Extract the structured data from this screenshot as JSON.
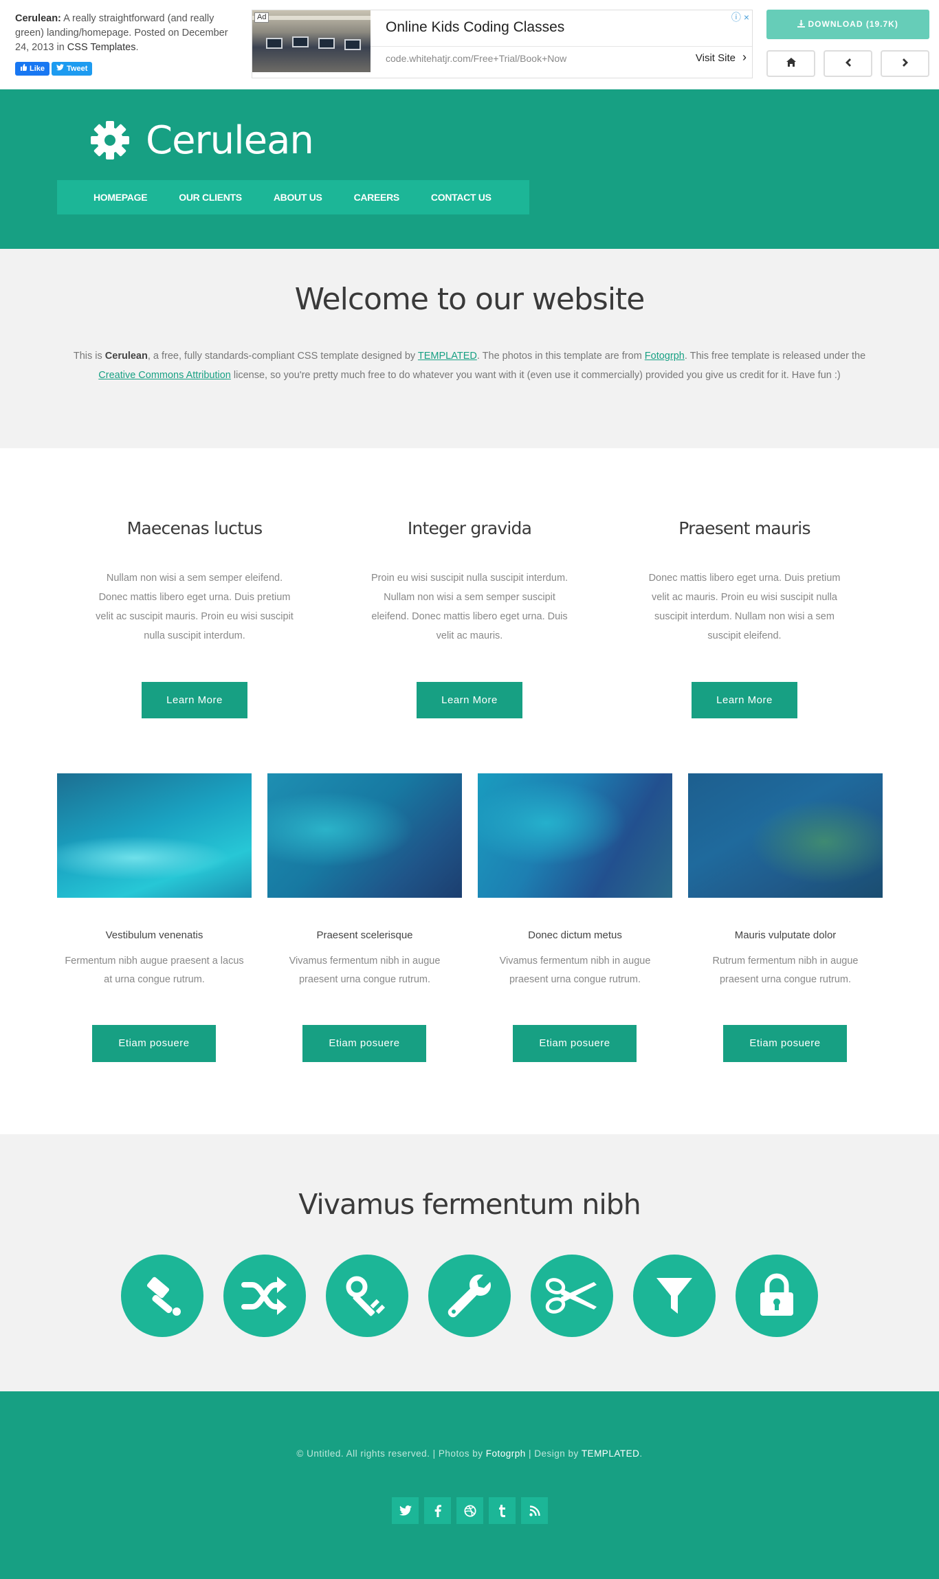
{
  "topbar": {
    "info_name": "Cerulean:",
    "info_text": "A really straightforward (and really green) landing/homepage. Posted on December 24, 2013 in",
    "info_category": "CSS Templates",
    "info_end": ".",
    "like_label": "Like",
    "tweet_label": "Tweet",
    "download_label": "DOWNLOAD (19.7K)"
  },
  "ad": {
    "badge": "Ad",
    "title": "Online Kids Coding Classes",
    "url": "code.whitehatjr.com/Free+Trial/Book+Now",
    "visit_label": "Visit Site",
    "close_icon": "×"
  },
  "header": {
    "logo_text": "Cerulean",
    "menu": [
      "HOMEPAGE",
      "OUR CLIENTS",
      "ABOUT US",
      "CAREERS",
      "CONTACT US"
    ]
  },
  "welcome": {
    "title": "Welcome to our website",
    "p_1": "This is ",
    "p_name": "Cerulean",
    "p_2": ", a free, fully standards-compliant CSS template designed by ",
    "p_link_templated": "TEMPLATED",
    "p_3": ". The photos in this template are from ",
    "p_link_fotogrph": "Fotogrph",
    "p_4": ". This free template is released under the ",
    "p_link_cc": "Creative Commons Attribution",
    "p_5": " license, so you're pretty much free to do whatever you want with it (even use it commercially) provided you give us credit for it. Have fun :)"
  },
  "features": [
    {
      "title": "Maecenas luctus",
      "text": "Nullam non wisi a sem semper eleifend. Donec mattis libero eget urna. Duis pretium velit ac suscipit mauris. Proin eu wisi suscipit nulla suscipit interdum.",
      "button": "Learn More"
    },
    {
      "title": "Integer gravida",
      "text": "Proin eu wisi suscipit nulla suscipit interdum. Nullam non wisi a sem semper suscipit eleifend. Donec mattis libero eget urna. Duis velit ac mauris.",
      "button": "Learn More"
    },
    {
      "title": "Praesent mauris",
      "text": "Donec mattis libero eget urna. Duis pretium velit ac mauris. Proin eu wisi suscipit nulla suscipit interdum. Nullam non wisi a sem suscipit eleifend.",
      "button": "Learn More"
    }
  ],
  "gallery": [
    {
      "title": "Vestibulum venenatis",
      "text": "Fermentum nibh augue praesent a lacus at urna congue rutrum.",
      "button": "Etiam posuere"
    },
    {
      "title": "Praesent scelerisque",
      "text": "Vivamus fermentum nibh in augue praesent urna congue rutrum.",
      "button": "Etiam posuere"
    },
    {
      "title": "Donec dictum metus",
      "text": "Vivamus fermentum nibh in augue praesent urna congue rutrum.",
      "button": "Etiam posuere"
    },
    {
      "title": "Mauris vulputate dolor",
      "text": "Rutrum fermentum nibh in augue praesent urna congue rutrum.",
      "button": "Etiam posuere"
    }
  ],
  "icons_section": {
    "title": "Vivamus fermentum nibh",
    "icons": [
      "gavel-icon",
      "shuffle-icon",
      "key-icon",
      "wrench-icon",
      "scissors-icon",
      "filter-icon",
      "lock-icon"
    ]
  },
  "footer": {
    "copy_1": "© Untitled. All rights reserved. | Photos by ",
    "copy_fotogrph": "Fotogrph",
    "copy_2": " | Design by ",
    "copy_templated": "TEMPLATED",
    "copy_3": ".",
    "social": [
      "twitter-icon",
      "facebook-icon",
      "dribbble-icon",
      "tumblr-icon",
      "rss-icon"
    ]
  },
  "colors": {
    "brand_green": "#17a083",
    "accent_green": "#1cb697",
    "download_button": "#66cdb8",
    "section_gray": "#f2f2f2"
  }
}
